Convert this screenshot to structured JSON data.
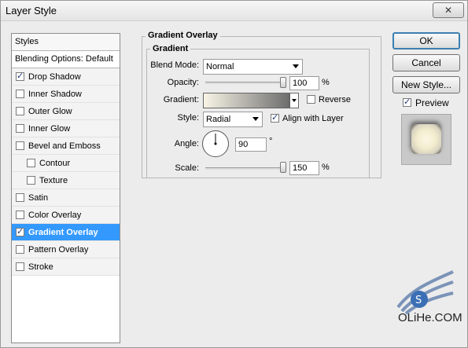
{
  "window": {
    "title": "Layer Style",
    "close_glyph": "✕"
  },
  "styles_panel": {
    "header": "Styles",
    "blending_options": "Blending Options: Default",
    "items": [
      {
        "label": "Drop Shadow",
        "checked": true,
        "indent": false,
        "selected": false
      },
      {
        "label": "Inner Shadow",
        "checked": false,
        "indent": false,
        "selected": false
      },
      {
        "label": "Outer Glow",
        "checked": false,
        "indent": false,
        "selected": false
      },
      {
        "label": "Inner Glow",
        "checked": false,
        "indent": false,
        "selected": false
      },
      {
        "label": "Bevel and Emboss",
        "checked": false,
        "indent": false,
        "selected": false
      },
      {
        "label": "Contour",
        "checked": false,
        "indent": true,
        "selected": false
      },
      {
        "label": "Texture",
        "checked": false,
        "indent": true,
        "selected": false
      },
      {
        "label": "Satin",
        "checked": false,
        "indent": false,
        "selected": false
      },
      {
        "label": "Color Overlay",
        "checked": false,
        "indent": false,
        "selected": false
      },
      {
        "label": "Gradient Overlay",
        "checked": true,
        "indent": false,
        "selected": true
      },
      {
        "label": "Pattern Overlay",
        "checked": false,
        "indent": false,
        "selected": false
      },
      {
        "label": "Stroke",
        "checked": false,
        "indent": false,
        "selected": false
      }
    ]
  },
  "gradient_overlay": {
    "section_title": "Gradient Overlay",
    "group_title": "Gradient",
    "blend_mode": {
      "label": "Blend Mode:",
      "value": "Normal"
    },
    "opacity": {
      "label": "Opacity:",
      "value": "100",
      "unit": "%",
      "level": 1.0
    },
    "gradient": {
      "label": "Gradient:",
      "reverse_label": "Reverse",
      "reverse_checked": false,
      "colors": [
        "#f8f4e6",
        "#6e6e6e"
      ]
    },
    "style": {
      "label": "Style:",
      "value": "Radial",
      "align_label": "Align with Layer",
      "align_checked": true
    },
    "angle": {
      "label": "Angle:",
      "value": "90",
      "unit": "°"
    },
    "scale": {
      "label": "Scale:",
      "value": "150",
      "unit": "%",
      "level": 1.0
    }
  },
  "buttons": {
    "ok": "OK",
    "cancel": "Cancel",
    "new_style": "New Style..."
  },
  "preview": {
    "label": "Preview",
    "checked": true
  },
  "watermark": {
    "text": "OLiHe.COM"
  }
}
